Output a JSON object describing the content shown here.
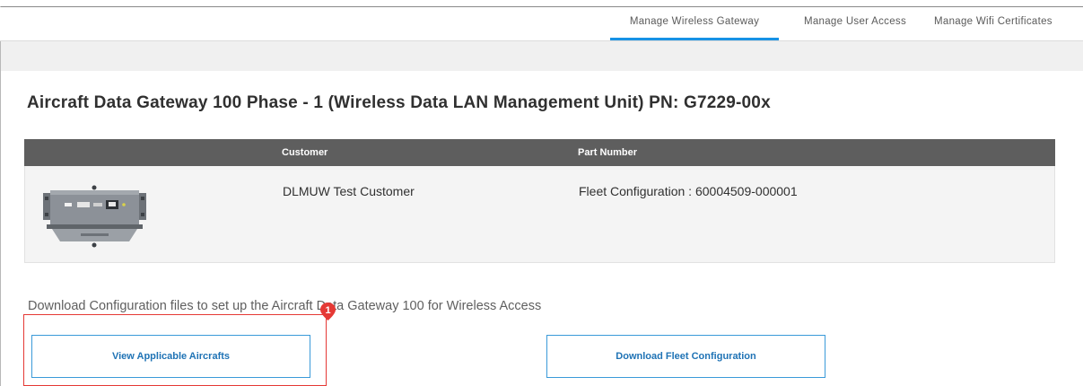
{
  "nav": {
    "tabs": [
      {
        "label": "Manage Wireless Gateway",
        "active": true
      },
      {
        "label": "Manage User Access",
        "active": false
      },
      {
        "label": "Manage Wifi Certificates",
        "active": false
      }
    ]
  },
  "page": {
    "title": "Aircraft Data Gateway 100 Phase - 1 (Wireless Data LAN Management Unit) PN: G7229-00x"
  },
  "table": {
    "headers": {
      "customer": "Customer",
      "part_number": "Part Number"
    },
    "row": {
      "image_icon": "device-gateway-image",
      "customer": "DLMUW Test Customer",
      "part_number": "Fleet Configuration : 60004509-000001"
    }
  },
  "instructions": {
    "text": "Download Configuration files to set up the Aircraft Data Gateway 100 for Wireless Access"
  },
  "buttons": {
    "view_aircrafts": "View Applicable Aircrafts",
    "download_fleet": "Download Fleet Configuration"
  },
  "annotation": {
    "step_number": "1",
    "highlight_color": "#e53935"
  },
  "colors": {
    "accent": "#1792e5",
    "button_text": "#1f73b5",
    "table_header_bg": "#5e5e5e"
  }
}
